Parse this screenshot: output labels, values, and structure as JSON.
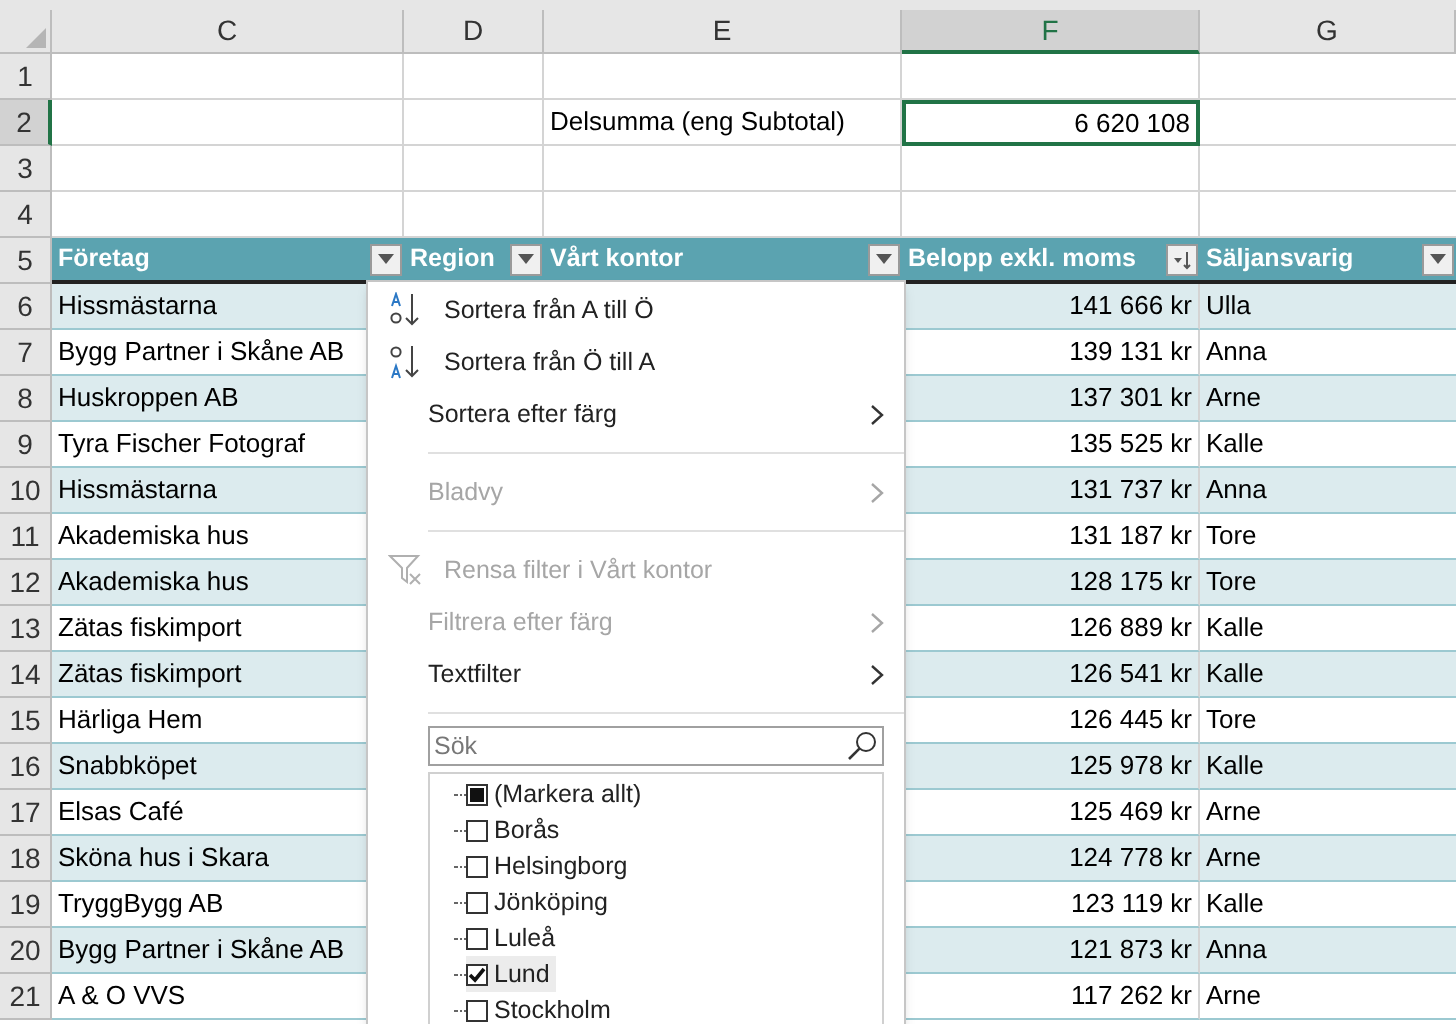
{
  "column_headers": [
    {
      "label": "C",
      "selected": false
    },
    {
      "label": "D",
      "selected": false
    },
    {
      "label": "E",
      "selected": false
    },
    {
      "label": "F",
      "selected": true
    },
    {
      "label": "G",
      "selected": false
    }
  ],
  "top_rows": [
    {
      "number": "1",
      "selected": false
    },
    {
      "number": "2",
      "selected": true,
      "label": "Delsumma (eng Subtotal)",
      "value": "6 620 108",
      "value_selected": true
    },
    {
      "number": "3",
      "selected": false
    },
    {
      "number": "4",
      "selected": false
    }
  ],
  "table": {
    "header_number": "5",
    "columns": [
      {
        "label": "Företag",
        "sorted": false
      },
      {
        "label": "Region",
        "sorted": false
      },
      {
        "label": "Vårt kontor",
        "sorted": false
      },
      {
        "label": "Belopp exkl. moms",
        "sorted": true
      },
      {
        "label": "Säljansvarig",
        "sorted": false
      }
    ],
    "rows": [
      {
        "number": "6",
        "company": "Hissmästarna",
        "amount": "141 666 kr",
        "seller": "Ulla"
      },
      {
        "number": "7",
        "company": "Bygg Partner i Skåne AB",
        "amount": "139 131 kr",
        "seller": "Anna"
      },
      {
        "number": "8",
        "company": "Huskroppen AB",
        "amount": "137 301 kr",
        "seller": "Arne"
      },
      {
        "number": "9",
        "company": "Tyra Fischer Fotograf",
        "amount": "135 525 kr",
        "seller": "Kalle"
      },
      {
        "number": "10",
        "company": "Hissmästarna",
        "amount": "131 737 kr",
        "seller": "Anna"
      },
      {
        "number": "11",
        "company": "Akademiska hus",
        "amount": "131 187 kr",
        "seller": "Tore"
      },
      {
        "number": "12",
        "company": "Akademiska hus",
        "amount": "128 175 kr",
        "seller": "Tore"
      },
      {
        "number": "13",
        "company": "Zätas fiskimport",
        "amount": "126 889 kr",
        "seller": "Kalle"
      },
      {
        "number": "14",
        "company": "Zätas fiskimport",
        "amount": "126 541 kr",
        "seller": "Kalle"
      },
      {
        "number": "15",
        "company": "Härliga Hem",
        "amount": "126 445 kr",
        "seller": "Tore"
      },
      {
        "number": "16",
        "company": "Snabbköpet",
        "amount": "125 978 kr",
        "seller": "Kalle"
      },
      {
        "number": "17",
        "company": "Elsas Café",
        "amount": "125 469 kr",
        "seller": "Arne"
      },
      {
        "number": "18",
        "company": "Sköna hus i Skara",
        "amount": "124 778 kr",
        "seller": "Arne"
      },
      {
        "number": "19",
        "company": "TryggBygg AB",
        "amount": "123 119 kr",
        "seller": "Kalle"
      },
      {
        "number": "20",
        "company": "Bygg Partner i Skåne AB",
        "amount": "121 873 kr",
        "seller": "Anna"
      },
      {
        "number": "21",
        "company": "A & O VVS",
        "amount": "117 262 kr",
        "seller": "Arne"
      }
    ]
  },
  "filter_menu": {
    "items": [
      {
        "kind": "sort_asc",
        "label": "Sortera från A till Ö",
        "disabled": false
      },
      {
        "kind": "sort_desc",
        "label": "Sortera från Ö till A",
        "disabled": false
      },
      {
        "kind": "submenu",
        "label": "Sortera efter färg",
        "disabled": false
      },
      {
        "kind": "separator"
      },
      {
        "kind": "submenu",
        "label": "Bladvy",
        "disabled": true
      },
      {
        "kind": "separator"
      },
      {
        "kind": "clear",
        "label": "Rensa filter i Vårt kontor",
        "disabled": true
      },
      {
        "kind": "submenu",
        "label": "Filtrera efter färg",
        "disabled": true
      },
      {
        "kind": "submenu",
        "label": "Textfilter",
        "disabled": false
      },
      {
        "kind": "separator"
      }
    ],
    "search": {
      "placeholder": "Sök"
    },
    "values": [
      {
        "label": "(Markera allt)",
        "checked": false,
        "mixed": true,
        "selected": false
      },
      {
        "label": "Borås",
        "checked": false,
        "selected": false
      },
      {
        "label": "Helsingborg",
        "checked": false,
        "selected": false
      },
      {
        "label": "Jönköping",
        "checked": false,
        "selected": false
      },
      {
        "label": "Luleå",
        "checked": false,
        "selected": false
      },
      {
        "label": "Lund",
        "checked": true,
        "selected": true
      },
      {
        "label": "Stockholm",
        "checked": false,
        "selected": false
      }
    ]
  }
}
